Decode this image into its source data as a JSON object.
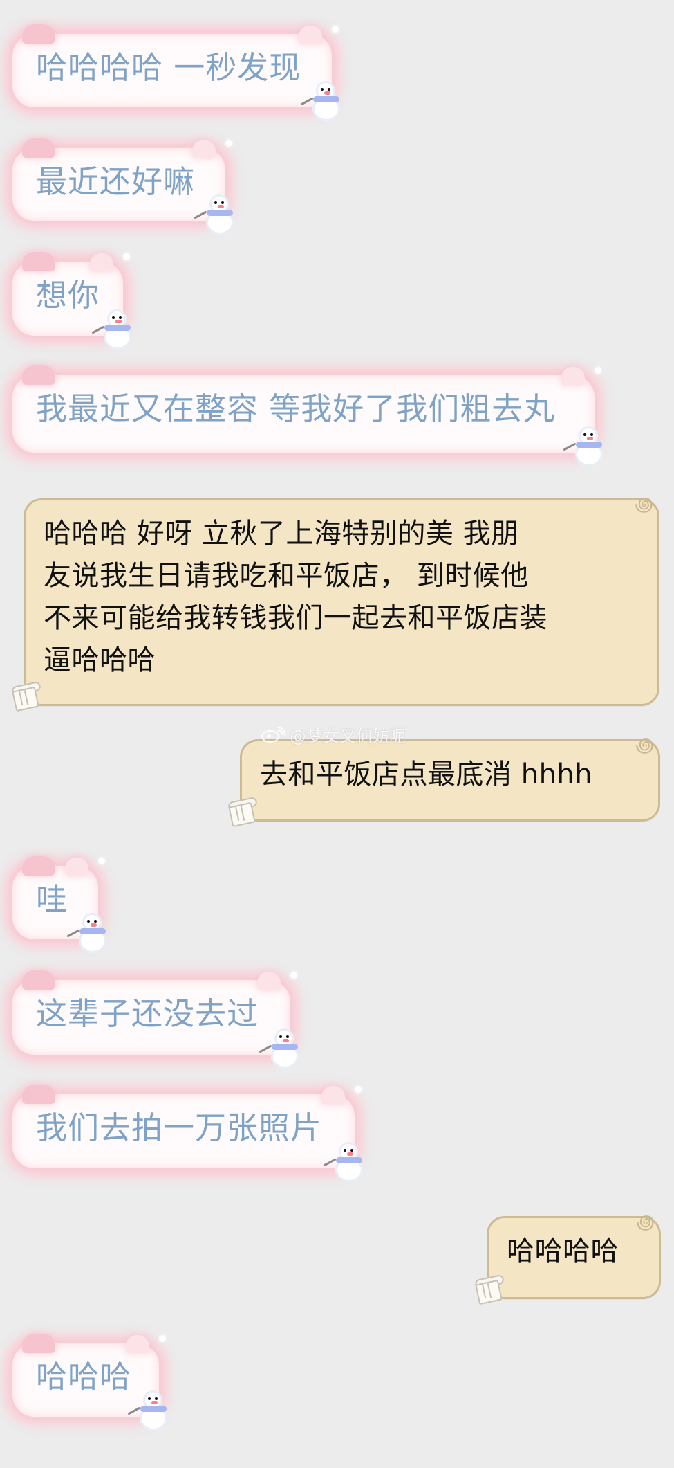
{
  "colors": {
    "background": "#ececec",
    "incoming_text": "#7ea3c7",
    "incoming_bubble": "#fffafb",
    "incoming_glow": "#f6cfd6",
    "outgoing_bubble": "#f4e5c5",
    "outgoing_border": "#cdbb94",
    "outgoing_text": "#111111"
  },
  "icons": {
    "incoming_bubble_decoration": "snowman-icon",
    "outgoing_bubble_decoration_top": "cloud-swirl-icon",
    "outgoing_bubble_decoration_bottom": "pillar-icon",
    "watermark_icon": "weibo-icon"
  },
  "watermark": {
    "text": "@梦女又何妨呢"
  },
  "messages": [
    {
      "side": "left",
      "text": "哈哈哈哈 一秒发现"
    },
    {
      "side": "left",
      "text": "最近还好嘛"
    },
    {
      "side": "left",
      "text": "想你"
    },
    {
      "side": "left",
      "text": "我最近又在整容 等我好了我们粗去丸"
    },
    {
      "side": "beige",
      "lines": [
        "哈哈哈 好呀 立秋了上海特别的美   我朋",
        "友说我生日请我吃和平饭店，  到时候他",
        "不来可能给我转钱我们一起去和平饭店装",
        "逼哈哈哈"
      ]
    },
    {
      "side": "beige",
      "text": "去和平饭店点最底消 hhhh"
    },
    {
      "side": "left",
      "text": "哇"
    },
    {
      "side": "left",
      "text": "这辈子还没去过"
    },
    {
      "side": "left",
      "text": "我们去拍一万张照片"
    },
    {
      "side": "beige",
      "text": "哈哈哈哈"
    },
    {
      "side": "left",
      "text": "哈哈哈"
    }
  ]
}
